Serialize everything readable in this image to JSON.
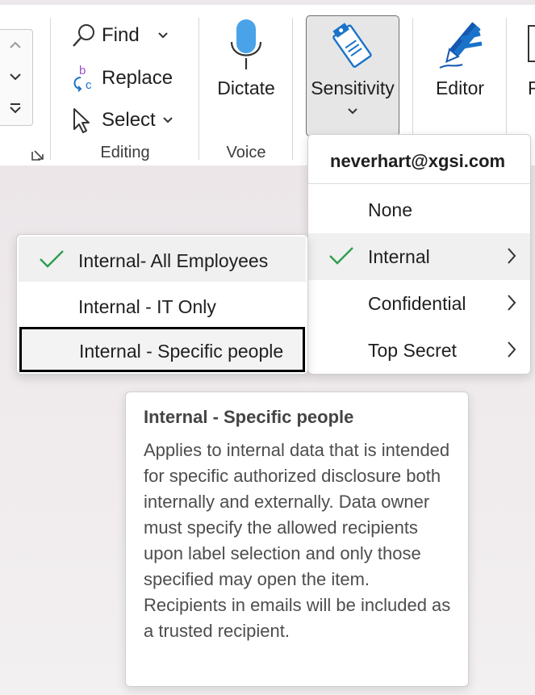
{
  "ribbon": {
    "editing": {
      "find_label": "Find",
      "replace_label": "Replace",
      "select_label": "Select",
      "group_label": "Editing"
    },
    "voice": {
      "dictate_label": "Dictate",
      "group_label": "Voice"
    },
    "sensitivity_label": "Sensitivity",
    "editor_label": "Editor",
    "cut_off_label": "R"
  },
  "sensitivity_menu": {
    "account": "neverhart@xgsi.com",
    "items": [
      {
        "label": "None",
        "checked": false,
        "has_submenu": false
      },
      {
        "label": "Internal",
        "checked": true,
        "has_submenu": true
      },
      {
        "label": "Confidential",
        "checked": false,
        "has_submenu": true
      },
      {
        "label": "Top Secret",
        "checked": false,
        "has_submenu": true
      }
    ]
  },
  "internal_submenu": {
    "items": [
      {
        "label": "Internal- All Employees",
        "checked": true
      },
      {
        "label": "Internal - IT Only",
        "checked": false
      },
      {
        "label": "Internal - Specific people",
        "checked": false
      }
    ]
  },
  "tooltip": {
    "title": "Internal - Specific people",
    "body": "Applies to internal data that is intended for specific authorized disclosure both internally and externally. Data owner must specify the allowed recipients upon label selection and only those specified may open the item. Recipients in emails will be included as a trusted recipient."
  },
  "colors": {
    "check_green": "#2e9e4e",
    "icon_blue": "#1a73c9",
    "icon_dark_blue": "#1558b0"
  }
}
